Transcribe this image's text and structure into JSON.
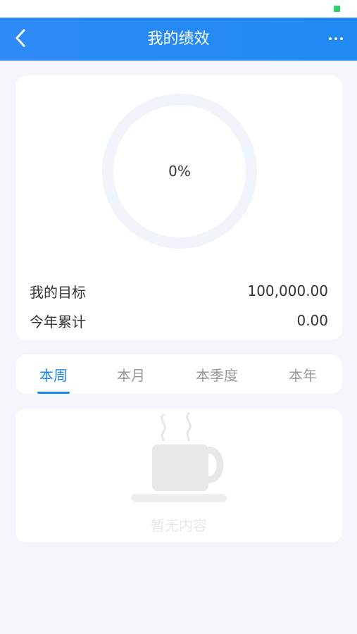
{
  "header": {
    "title": "我的绩效"
  },
  "summary": {
    "progress_percent": 0,
    "progress_label": "0%",
    "target_label": "我的目标",
    "target_value": "100,000.00",
    "ytd_label": "今年累计",
    "ytd_value": "0.00"
  },
  "tabs": [
    {
      "label": "本周",
      "active": true
    },
    {
      "label": "本月",
      "active": false
    },
    {
      "label": "本季度",
      "active": false
    },
    {
      "label": "本年",
      "active": false
    }
  ],
  "empty_state": {
    "icon": "coffee-cup-icon",
    "text": "暂无内容"
  },
  "colors": {
    "accent": "#1b86f2",
    "header_bg": "#2e8af6",
    "ring": "#f1f4fb",
    "status_battery": "#2bd069"
  }
}
